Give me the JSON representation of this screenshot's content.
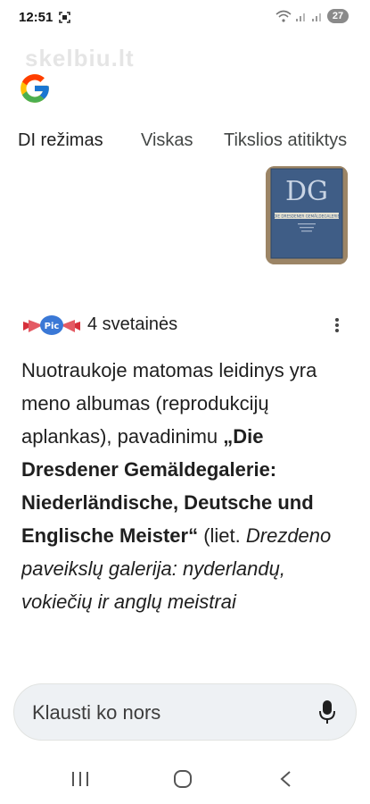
{
  "status_bar": {
    "time": "12:51",
    "battery": "27",
    "icons": [
      "screenshot-icon",
      "wifi-icon",
      "signal-icon",
      "signal-icon",
      "battery-icon"
    ]
  },
  "watermark": "skelbiu.lt",
  "tabs": [
    {
      "label": "DI režimas",
      "active": true
    },
    {
      "label": "Viskas",
      "active": false
    },
    {
      "label": "Tikslios atitiktys",
      "active": false
    }
  ],
  "sources": {
    "count_label": "4 svetainės"
  },
  "answer": {
    "p1": "Nuotraukoje matomas leidinys yra meno albumas (reprodukcijų aplankas), pavadinimu ",
    "bold": "„Die Dresdener Gemäldegalerie: Niederländische, Deutsche und Englische Meister“",
    "p2": " (liet. ",
    "italic": "Drezdeno paveikslų galerija: nyderlandų, vokiečių ir anglų meistrai"
  },
  "thumbnail": {
    "monogram": "DG",
    "caption": "DIE DRESDENER GEMÄLDEGALERIE"
  },
  "ask_bar": {
    "placeholder": "Klausti ko nors"
  },
  "colors": {
    "accent": "#1f1f1f",
    "ask_bar_bg": "#eef1f4",
    "book_blue": "#3f5d86"
  }
}
